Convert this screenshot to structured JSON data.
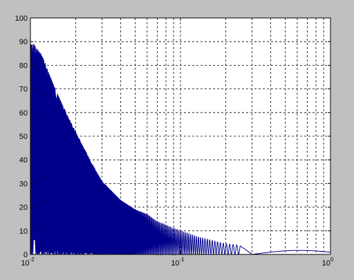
{
  "chart_data": {
    "type": "line",
    "x_scale": "log",
    "y_scale": "linear",
    "xlim": [
      0.01,
      1
    ],
    "ylim": [
      0,
      100
    ],
    "grid": true,
    "grid_style": "dashed",
    "line_color": "#00008b",
    "background_color": "#c0c0c0",
    "axes_background": "#ffffff",
    "xticks": [
      {
        "value": 0.01,
        "base": "10",
        "exp": "-2"
      },
      {
        "value": 0.1,
        "base": "10",
        "exp": "-1"
      },
      {
        "value": 1,
        "base": "10",
        "exp": "0"
      }
    ],
    "yticks": [
      "0",
      "10",
      "20",
      "30",
      "40",
      "50",
      "60",
      "70",
      "80",
      "90",
      "100"
    ],
    "series": [
      {
        "curve": "damped oscillation in log-frequency, peaks decaying with x",
        "envelope_peaks": [
          {
            "x": 0.0105,
            "y": 89
          },
          {
            "x": 0.012,
            "y": 84
          },
          {
            "x": 0.014,
            "y": 73
          },
          {
            "x": 0.017,
            "y": 61
          },
          {
            "x": 0.02,
            "y": 52
          },
          {
            "x": 0.025,
            "y": 40
          },
          {
            "x": 0.03,
            "y": 31
          },
          {
            "x": 0.04,
            "y": 23
          },
          {
            "x": 0.05,
            "y": 19
          },
          {
            "x": 0.06,
            "y": 17
          },
          {
            "x": 0.07,
            "y": 14
          },
          {
            "x": 0.09,
            "y": 11
          },
          {
            "x": 0.13,
            "y": 7.5
          },
          {
            "x": 0.2,
            "y": 4.5
          },
          {
            "x": 0.6,
            "y": 1.7
          },
          {
            "x": 1,
            "y": 1
          }
        ],
        "min_values": [
          {
            "x": 0.3,
            "y": 0
          },
          {
            "x": 1,
            "y": 0.5
          }
        ],
        "oscillation_period_inv_x": 8.3
      }
    ]
  }
}
